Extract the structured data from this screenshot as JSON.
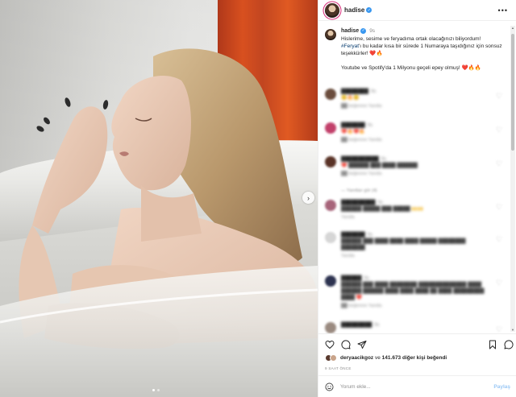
{
  "post": {
    "username": "hadise",
    "verified_icon": "verified-badge-icon",
    "more_label": "•••",
    "image_alt": "Woman in a white bathtub with wet hair",
    "carousel": {
      "total": 2,
      "current": 1
    },
    "next_arrow": "›"
  },
  "caption": {
    "username": "hadise",
    "time": "9s",
    "line1": "Hislerime, sesime ve feryadıma ortak olacağınızı biliyordum!",
    "hashtag": "#Feryat",
    "line2_rest": "'ı bu kadar kısa bir sürede 1 Numaraya taşıdığınız için sonsuz teşekkürler! ❤️🔥",
    "line3": "Youtube ve Spotify'da 1 Milyonu geçeli epey olmuş! ❤️🔥🔥"
  },
  "comments": [
    {
      "user": "████████",
      "time": "9s",
      "text": "😊🔥😊",
      "meta": "██ beğenme  Yanıtla",
      "avatar_color": "#6b4d3d"
    },
    {
      "user": "███████",
      "time": "9s",
      "text": "❤️🔥❤️🔥",
      "meta": "██ beğenme  Yanıtla",
      "avatar_color": "#c2406a"
    },
    {
      "user": "███████████",
      "time": "9s",
      "text": "❤️ ██████ ███ ████ ██████",
      "meta": "██ beğenme  Yanıtla",
      "avatar_color": "#5a3327"
    },
    {
      "user": "██████████",
      "time": "9s",
      "text": "██████ █████ ███ █████ 🙌🙌",
      "meta": "Yanıtla",
      "avatar_color": "#a7647a"
    },
    {
      "user": "███████",
      "time": "9s",
      "text": "██████ ███ ████ ████ ████ █████ ████████ ███████",
      "meta": "Yanıtla",
      "avatar_color": "#d6d6d6"
    },
    {
      "user": "██████",
      "time": "9s",
      "text": "██████ ███ ████ ████████ ██████████████ ████ ██████ ██████ ████ ████ ████ ██ ████ █████████ ████ ❤️",
      "meta": "██ beğenme  Yanıtla",
      "avatar_color": "#2d3350"
    },
    {
      "user": "█████████",
      "time": "9s",
      "text": "",
      "meta": "",
      "avatar_color": "#9a8a80"
    }
  ],
  "replies_label": "— Yanıtları gör (4)",
  "actions": {
    "like_icon": "heart-icon",
    "comment_icon": "comment-icon",
    "share_icon": "share-icon",
    "save_icon": "bookmark-icon"
  },
  "likes": {
    "first_user": "deryaacikgoz",
    "middle": " ve ",
    "count": "141.673",
    "suffix": " diğer kişi beğendi"
  },
  "time_ago": "9 SAAT ÖNCE",
  "comment_box": {
    "placeholder": "Yorum ekle...",
    "post_label": "Paylaş"
  }
}
